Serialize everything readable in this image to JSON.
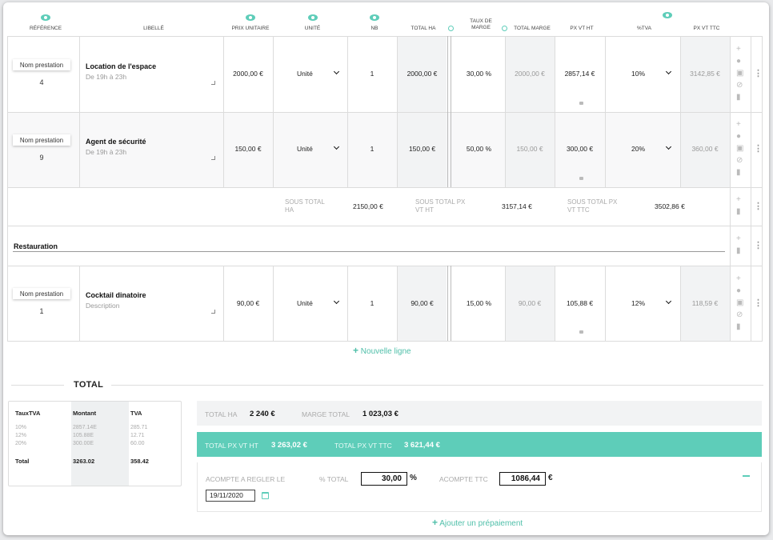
{
  "columns": {
    "reference": "RÉFÉRENCE",
    "libelle": "LIBELLÉ",
    "prix_unitaire": "PRIX UNITAIRE",
    "unite": "UNITÉ",
    "nb": "NB",
    "total_ha": "TOTAL HA",
    "taux_marge": "TAUX DE MARGE",
    "total_marge": "TOTAL MARGE",
    "px_vt_ht": "PX VT HT",
    "tva": "%TVA",
    "px_vt_ttc": "PX VT TTC"
  },
  "rows": [
    {
      "ref_label": "Nom prestation",
      "ref_num": "4",
      "title": "Location de l'espace",
      "desc": "De 19h à 23h",
      "prix": "2000,00 €",
      "unite": "Unité",
      "nb": "1",
      "total_ha": "2000,00 €",
      "taux": "30,00 %",
      "total_marge": "2000,00 €",
      "px_ht": "2857,14 €",
      "tva": "10%",
      "px_ttc": "3142,85 €"
    },
    {
      "ref_label": "Nom prestation",
      "ref_num": "9",
      "title": "Agent de sécurité",
      "desc": "De 19h à 23h",
      "prix": "150,00 €",
      "unite": "Unité",
      "nb": "1",
      "total_ha": "150,00 €",
      "taux": "50,00 %",
      "total_marge": "150,00 €",
      "px_ht": "300,00 €",
      "tva": "20%",
      "px_ttc": "360,00 €"
    },
    {
      "ref_label": "Nom prestation",
      "ref_num": "1",
      "title": "Cocktail dinatoire",
      "desc": "Description",
      "prix": "90,00 €",
      "unite": "Unité",
      "nb": "1",
      "total_ha": "90,00 €",
      "taux": "15,00 %",
      "total_marge": "90,00 €",
      "px_ht": "105,88 €",
      "tva": "12%",
      "px_ttc": "118,59 €"
    }
  ],
  "subtotal": {
    "ha_label": "SOUS TOTAL HA",
    "ha_value": "2150,00 €",
    "ht_label": "SOUS TOTAL PX VT HT",
    "ht_value": "3157,14 €",
    "ttc_label": "SOUS TOTAL PX VT TTC",
    "ttc_value": "3502,86 €"
  },
  "section": {
    "title": "Restauration"
  },
  "new_line": "Nouvelle ligne",
  "total": {
    "title": "TOTAL",
    "vat_headers": [
      "TauxTVA",
      "Montant",
      "TVA"
    ],
    "vat_rows": [
      [
        "10%",
        "2857.14E",
        "285.71"
      ],
      [
        "12%",
        "105.88E",
        "12.71"
      ],
      [
        "20%",
        "300.00E",
        "60.00"
      ]
    ],
    "vat_total": [
      "Total",
      "3263.02",
      "358.42"
    ],
    "total_ha_label": "TOTAL HA",
    "total_ha": "2 240 €",
    "marge_label": "MARGE TOTAL",
    "marge": "1 023,03 €",
    "px_ht_label": "TOTAL PX VT HT",
    "px_ht": "3 263,02 €",
    "px_ttc_label": "TOTAL PX VT TTC",
    "px_ttc": "3 621,44 €"
  },
  "acompte": {
    "label": "ACOMPTE A REGLER LE",
    "pct_label": "% TOTAL",
    "pct_value": "30,00",
    "pct_unit": "%",
    "ttc_label": "ACOMPTE TTC",
    "ttc_value": "1086,44",
    "ttc_unit": "€",
    "date": "19/11/2020"
  },
  "add_prepayment": "Ajouter un prépaiement",
  "colors": {
    "accent": "#5ecdb9"
  }
}
